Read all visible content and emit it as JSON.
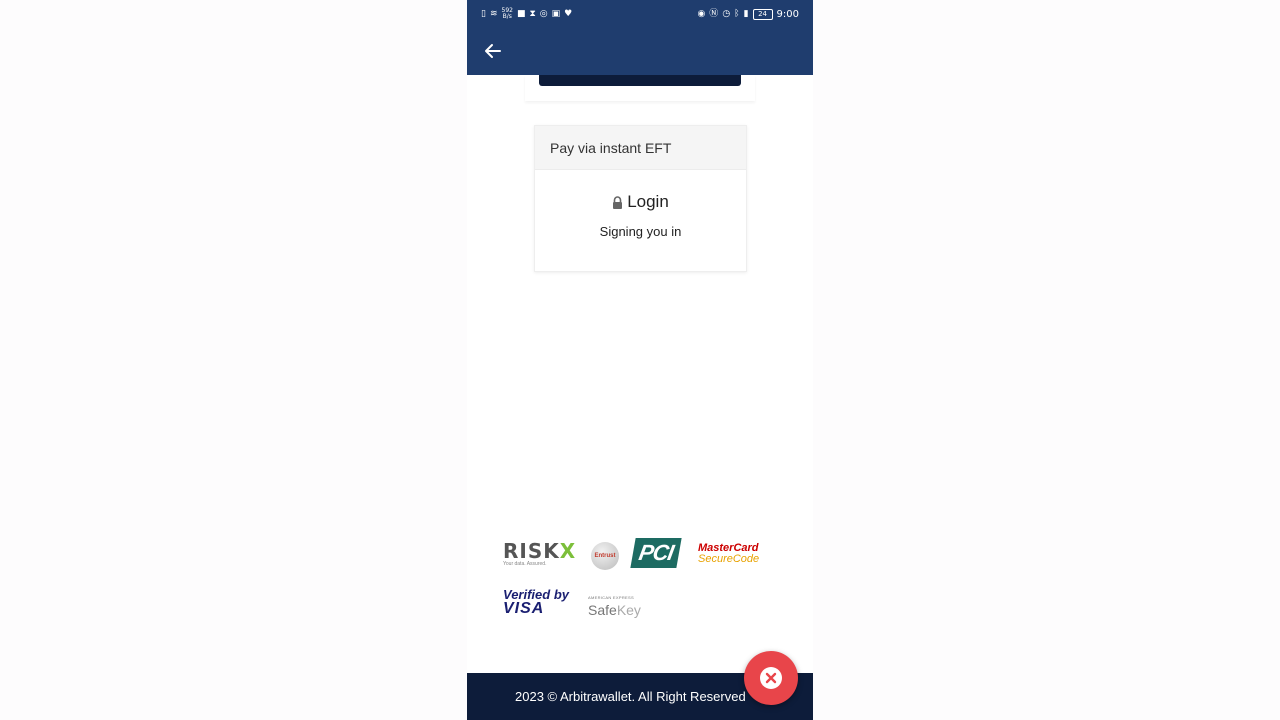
{
  "status_bar": {
    "net_speed_top": "592",
    "net_speed_bottom": "B/s",
    "battery": "24",
    "time": "9:00"
  },
  "colors": {
    "appbar": "#1f3d6e",
    "footer": "#0d1c3a",
    "close_button": "#e8454a"
  },
  "card": {
    "header": "Pay via instant EFT",
    "title": "Login",
    "subtitle": "Signing you in"
  },
  "logos": {
    "riskx_main": "RISK",
    "riskx_x": "X",
    "riskx_tagline": "Your data. Assured.",
    "entrust": "Entrust",
    "pci": "PCI",
    "mastercard_line1": "MasterCard",
    "mastercard_line2": "SecureCode",
    "visa_line1": "Verified by",
    "visa_line2": "VISA",
    "safekey_line1": "AMERICAN EXPRESS",
    "safekey_main": "Safe",
    "safekey_light": "Key"
  },
  "footer": {
    "text": "2023 © Arbitrawallet. All Right Reserved"
  },
  "icons": {
    "back": "arrow-left-icon",
    "lock": "lock-icon",
    "close": "close-icon"
  }
}
